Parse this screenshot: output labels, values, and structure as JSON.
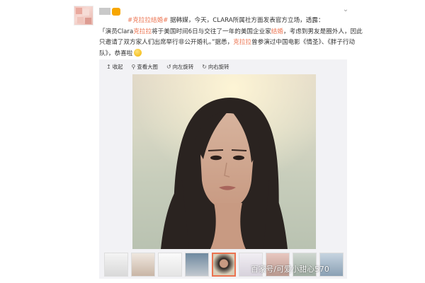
{
  "post": {
    "text": {
      "topic": "#克拉拉结婚#",
      "p1": " 据韩媒，今天，CLARA所属社方面发表官方立场，透露：",
      "masked": "                       ",
      "p2": "「演员Clara",
      "name1": "克拉拉",
      "p3": "将于美国时间6日与交往了一年的美国企业家",
      "kw1": "结婚",
      "p4": "，考虑到男友是圈外人，因此只邀请了双方家人们出席举行非公开婚礼。”据悉，",
      "name2": "克拉拉",
      "p5": "曾参演过中国电影《情圣》、《胖子行动队》，恭喜啦"
    }
  },
  "media": {
    "toolbar": {
      "collapse": "收起",
      "view_large": "查看大图",
      "rotate_left": "向左旋转",
      "rotate_right": "向右旋转"
    },
    "icons": {
      "collapse": "collapse-arrow-icon",
      "view_large": "magnifier-icon",
      "rotate_left": "rotate-left-icon",
      "rotate_right": "rotate-right-icon"
    },
    "thumbnail_count": 10,
    "active_thumbnail": 5
  },
  "watermark": "百家号/可爱小甜心570",
  "colors": {
    "accent": "#eb7350",
    "vip": "#f7a600",
    "media_bg": "#f2f2f5"
  }
}
